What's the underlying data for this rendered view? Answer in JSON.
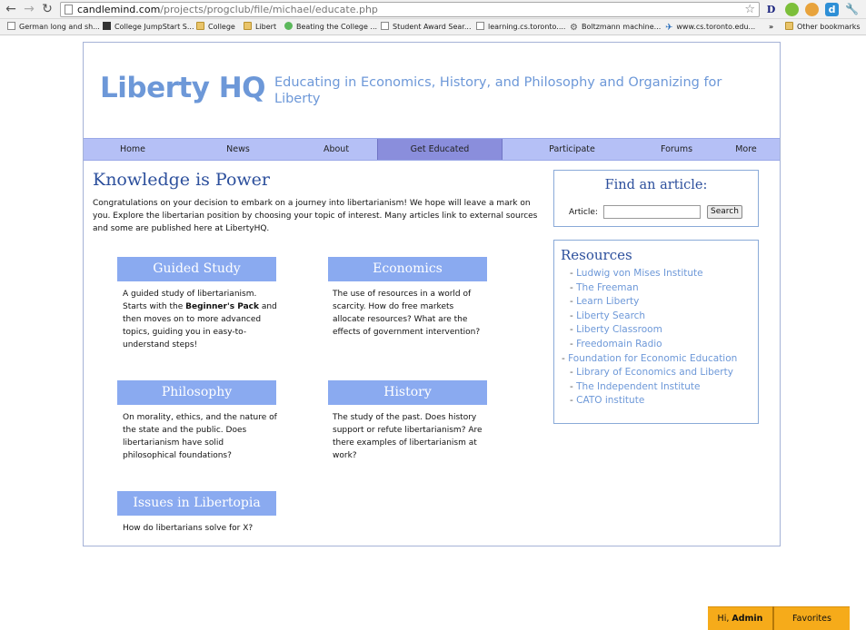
{
  "browser": {
    "url_host": "candlemind.com",
    "url_path": "/projects/progclub/file/michael/educate.php",
    "extensions": [
      "D",
      "d"
    ]
  },
  "bookmarks": [
    {
      "label": "German long and sh...",
      "icon": "page"
    },
    {
      "label": "College JumpStart S...",
      "icon": "cube"
    },
    {
      "label": "College",
      "icon": "folder"
    },
    {
      "label": "Libert",
      "icon": "folder"
    },
    {
      "label": "Beating the College ...",
      "icon": "circle"
    },
    {
      "label": "Student Award Sear...",
      "icon": "page"
    },
    {
      "label": "learning.cs.toronto....",
      "icon": "page"
    },
    {
      "label": "Boltzmann machine...",
      "icon": "gear"
    },
    {
      "label": "www.cs.toronto.edu...",
      "icon": "plane"
    },
    {
      "label": "»",
      "icon": ""
    },
    {
      "label": "Other bookmarks",
      "icon": "folder"
    }
  ],
  "site": {
    "logo": "Liberty HQ",
    "tagline": "Educating in Economics, History, and Philosophy and Organizing for Liberty",
    "nav": [
      "Home",
      "News",
      "About",
      "Get Educated",
      "Participate",
      "Forums",
      "More"
    ],
    "active_nav": "Get Educated",
    "heading": "Knowledge is Power",
    "intro": "Congratulations on your decision to embark on a journey into libertarianism! We hope will leave a mark on you. Explore the libertarian position by choosing your topic of interest. Many articles link to external sources and some are published here at LibertyHQ.",
    "topics": [
      {
        "title": "Guided Study",
        "desc_a": "A guided study of libertarianism. Starts with the ",
        "desc_bold": "Beginner's Pack",
        "desc_b": " and then moves on to more advanced topics, guiding you in easy-to-understand steps!"
      },
      {
        "title": "Economics",
        "desc_a": "The use of resources in a world of scarcity. How do free markets allocate resources? What are the effects of government intervention?",
        "desc_bold": "",
        "desc_b": ""
      },
      {
        "title": "Philosophy",
        "desc_a": "On morality, ethics, and the nature of the state and the public. Does libertarianism have solid philosophical foundations?",
        "desc_bold": "",
        "desc_b": ""
      },
      {
        "title": "History",
        "desc_a": "The study of the past. Does history support or refute libertarianism? Are there examples of libertarianism at work?",
        "desc_bold": "",
        "desc_b": ""
      },
      {
        "title": "Issues in Libertopia",
        "desc_a": "How do libertarians solve for X?",
        "desc_bold": "",
        "desc_b": ""
      }
    ],
    "find": {
      "title": "Find an article:",
      "label": "Article:",
      "value": "",
      "button": "Search"
    },
    "resources": {
      "title": "Resources",
      "items": [
        "Ludwig von Mises Institute",
        "The Freeman",
        "Learn Liberty",
        "Liberty Search",
        "Liberty Classroom",
        "Freedomain Radio",
        "Foundation for Economic Education",
        "Library of Economics and Liberty",
        "The Independent Institute",
        "CATO institute"
      ]
    }
  },
  "footer_tabs": {
    "greeting": "Hi, ",
    "user": "Admin",
    "favorites": "Favorites"
  },
  "colors": {
    "brand_blue": "#6d98d8",
    "nav_bg": "#b5c0f6",
    "nav_active": "#8a8edc",
    "topic_bg": "#8aaaf0",
    "heading_blue": "#2c4f9c",
    "tab_orange": "#f6ab1a"
  }
}
